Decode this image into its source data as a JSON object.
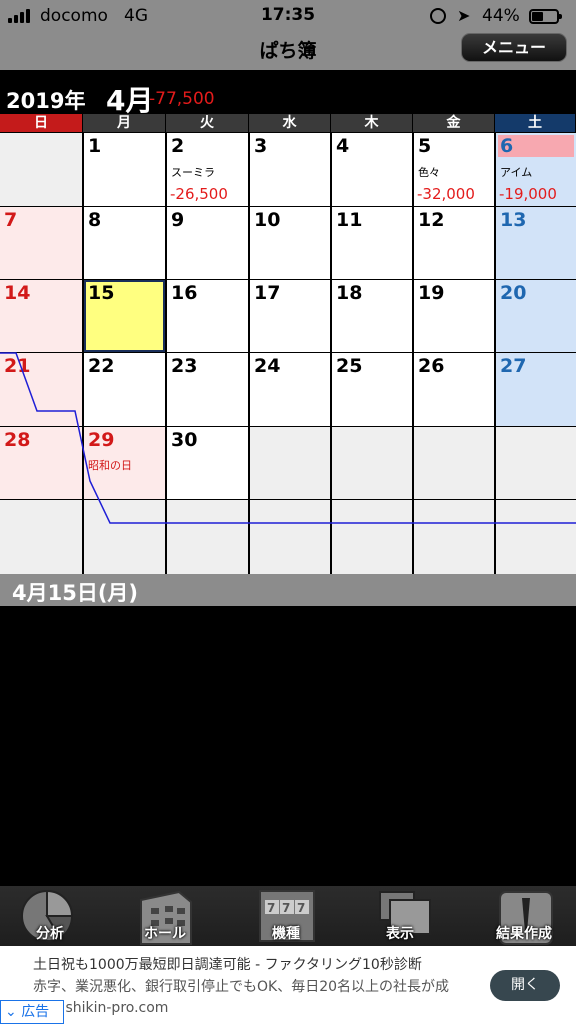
{
  "status_bar": {
    "carrier": "docomo",
    "network": "4G",
    "time": "17:35",
    "battery": "44%",
    "battery_level": 0.44,
    "icons": [
      "signal-icon",
      "rotation-lock-icon",
      "location-arrow-icon",
      "battery-icon"
    ]
  },
  "nav": {
    "title": "ぱち簿",
    "menu_label": "メニュー"
  },
  "month_header": {
    "year": "2019年",
    "month": "4月",
    "total": "-77,500"
  },
  "weekdays": [
    "日",
    "月",
    "火",
    "水",
    "木",
    "金",
    "土"
  ],
  "calendar": {
    "today": "15",
    "weeks": [
      [
        {
          "day": "",
          "type": "empty"
        },
        {
          "day": "1",
          "type": "weekday"
        },
        {
          "day": "2",
          "type": "weekday",
          "hall": "スーミラ",
          "amount": "-26,500"
        },
        {
          "day": "3",
          "type": "weekday"
        },
        {
          "day": "4",
          "type": "weekday"
        },
        {
          "day": "5",
          "type": "weekday",
          "hall": "色々",
          "amount": "-32,000"
        },
        {
          "day": "6",
          "type": "sat",
          "highlight": true,
          "hall": "アイム",
          "amount": "-19,000"
        }
      ],
      [
        {
          "day": "7",
          "type": "sun"
        },
        {
          "day": "8",
          "type": "weekday"
        },
        {
          "day": "9",
          "type": "weekday"
        },
        {
          "day": "10",
          "type": "weekday"
        },
        {
          "day": "11",
          "type": "weekday"
        },
        {
          "day": "12",
          "type": "weekday"
        },
        {
          "day": "13",
          "type": "sat"
        }
      ],
      [
        {
          "day": "14",
          "type": "sun"
        },
        {
          "day": "15",
          "type": "weekday"
        },
        {
          "day": "16",
          "type": "weekday"
        },
        {
          "day": "17",
          "type": "weekday"
        },
        {
          "day": "18",
          "type": "weekday"
        },
        {
          "day": "19",
          "type": "weekday"
        },
        {
          "day": "20",
          "type": "sat"
        }
      ],
      [
        {
          "day": "21",
          "type": "sun"
        },
        {
          "day": "22",
          "type": "weekday"
        },
        {
          "day": "23",
          "type": "weekday"
        },
        {
          "day": "24",
          "type": "weekday"
        },
        {
          "day": "25",
          "type": "weekday"
        },
        {
          "day": "26",
          "type": "weekday"
        },
        {
          "day": "27",
          "type": "sat"
        }
      ],
      [
        {
          "day": "28",
          "type": "sun"
        },
        {
          "day": "29",
          "type": "holiday",
          "holiday_name": "昭和の日"
        },
        {
          "day": "30",
          "type": "weekday"
        },
        {
          "day": "",
          "type": "empty"
        },
        {
          "day": "",
          "type": "empty"
        },
        {
          "day": "",
          "type": "empty"
        },
        {
          "day": "",
          "type": "empty"
        }
      ],
      [
        {
          "day": "",
          "type": "empty"
        },
        {
          "day": "",
          "type": "empty"
        },
        {
          "day": "",
          "type": "empty"
        },
        {
          "day": "",
          "type": "empty"
        },
        {
          "day": "",
          "type": "empty"
        },
        {
          "day": "",
          "type": "empty"
        },
        {
          "day": "",
          "type": "empty"
        }
      ]
    ],
    "trend_line_color": "#1f1fd6",
    "colors": {
      "sunday": "#d21919",
      "saturday": "#1f67b0",
      "amount": "#e31b1b",
      "today_fill": "#ffff80"
    }
  },
  "day_detail": {
    "title": "4月15日(月)"
  },
  "toolbar": {
    "items": [
      {
        "label": "分析",
        "icon": "pie-chart-icon"
      },
      {
        "label": "ホール",
        "icon": "building-icon"
      },
      {
        "label": "機種",
        "icon": "slot-machine-icon"
      },
      {
        "label": "表示",
        "icon": "windows-icon"
      },
      {
        "label": "結果作成",
        "icon": "pencil-icon"
      }
    ]
  },
  "ad": {
    "title": "土日祝も1000万最短即日調達可能 - ファクタリング10秒診断",
    "body": "赤字、業況悪化、銀行取引停止でもOK、毎日20名以上の社長が成功！ shikin-pro.com",
    "open_label": "開く",
    "ad_label": "広告"
  }
}
